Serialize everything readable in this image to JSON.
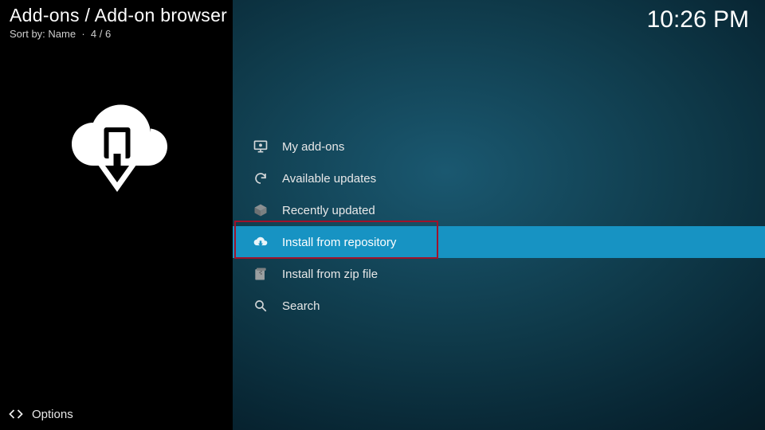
{
  "header": {
    "breadcrumb": "Add-ons / Add-on browser",
    "sort_label": "Sort by:",
    "sort_value": "Name",
    "position": "4 / 6"
  },
  "clock": "10:26 PM",
  "menu": {
    "items": [
      {
        "label": "My add-ons",
        "icon": "monitor-icon",
        "selected": false
      },
      {
        "label": "Available updates",
        "icon": "refresh-icon",
        "selected": false
      },
      {
        "label": "Recently updated",
        "icon": "box-icon",
        "selected": false
      },
      {
        "label": "Install from repository",
        "icon": "cloud-download-icon",
        "selected": true
      },
      {
        "label": "Install from zip file",
        "icon": "zip-icon",
        "selected": false
      },
      {
        "label": "Search",
        "icon": "search-icon",
        "selected": false
      }
    ]
  },
  "footer": {
    "options_label": "Options"
  }
}
